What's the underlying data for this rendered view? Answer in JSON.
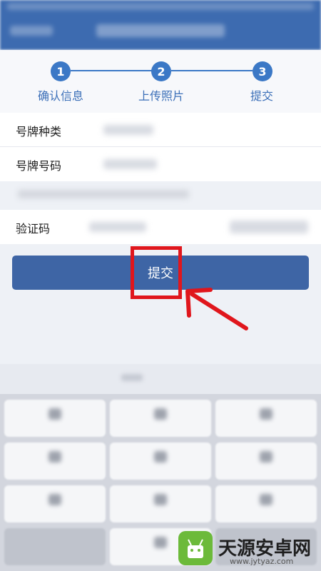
{
  "steps": [
    {
      "number": "1",
      "label": "确认信息"
    },
    {
      "number": "2",
      "label": "上传照片"
    },
    {
      "number": "3",
      "label": "提交"
    }
  ],
  "form": {
    "plate_type_label": "号牌种类",
    "plate_number_label": "号牌号码",
    "captcha_label": "验证码"
  },
  "submit_label": "提交",
  "watermark": {
    "text": "天源安卓网",
    "url": "www.jytyaz.com"
  },
  "colors": {
    "accent": "#3b78c6",
    "button": "#3e65a5",
    "highlight": "#e0161c"
  }
}
